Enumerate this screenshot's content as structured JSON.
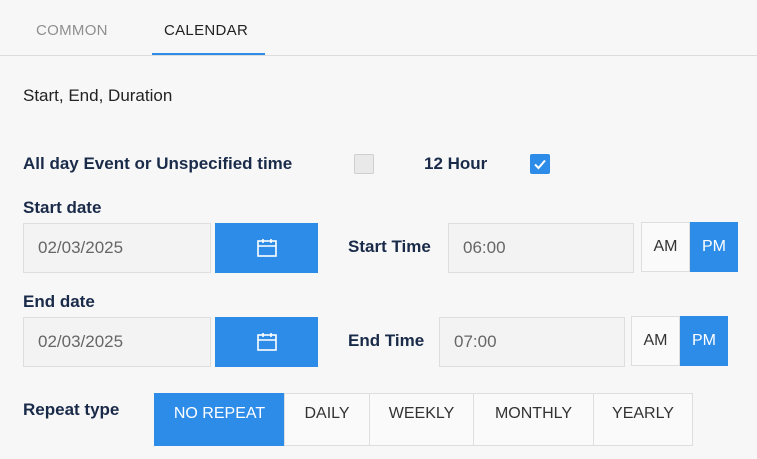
{
  "tabs": [
    {
      "label": "COMMON",
      "active": false
    },
    {
      "label": "CALENDAR",
      "active": true
    }
  ],
  "section_desc": "Start, End, Duration",
  "all_day": {
    "label": "All day Event or Unspecified time",
    "checked": false
  },
  "twelve_hour": {
    "label": "12 Hour",
    "checked": true
  },
  "start": {
    "date_label": "Start date",
    "date_value": "02/03/2025",
    "time_label": "Start Time",
    "time_value": "06:00",
    "am": "AM",
    "pm": "PM",
    "selected": "PM"
  },
  "end": {
    "date_label": "End date",
    "date_value": "02/03/2025",
    "time_label": "End Time",
    "time_value": "07:00",
    "am": "AM",
    "pm": "PM",
    "selected": "PM"
  },
  "repeat": {
    "label": "Repeat type",
    "options": [
      "NO REPEAT",
      "DAILY",
      "WEEKLY",
      "MONTHLY",
      "YEARLY"
    ],
    "selected": "NO REPEAT"
  },
  "colors": {
    "accent": "#2d8ce8",
    "label": "#1a2b4a"
  },
  "icons": {
    "calendar": "calendar-icon",
    "check": "check-icon"
  }
}
